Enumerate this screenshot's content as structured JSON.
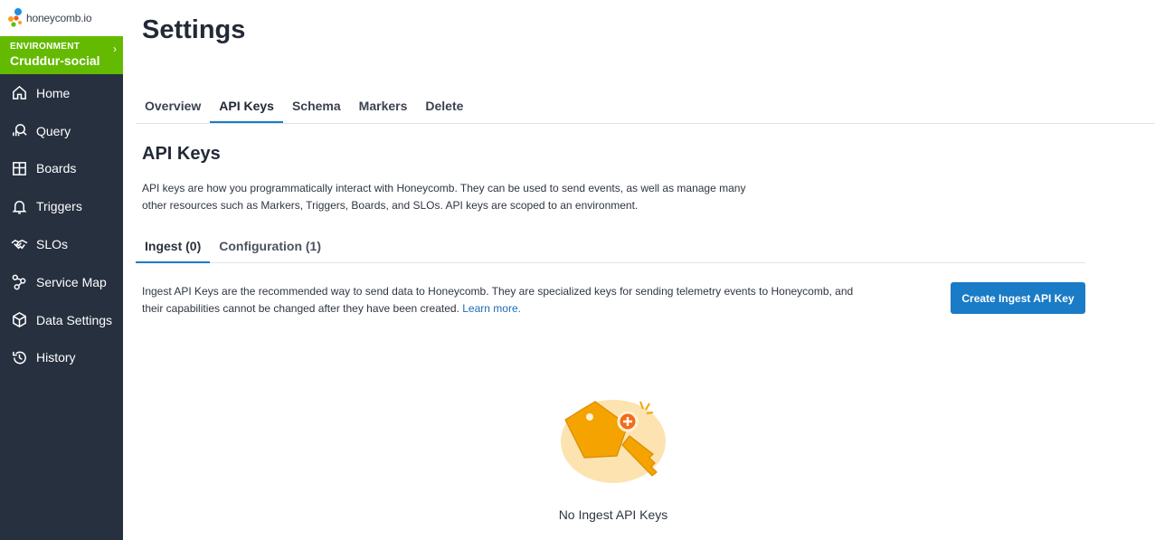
{
  "app": {
    "logo_text": "honeycomb.io"
  },
  "environment": {
    "label": "ENVIRONMENT",
    "name": "Cruddur-social"
  },
  "sidebar": {
    "items": [
      {
        "label": "Home",
        "icon": "home-icon"
      },
      {
        "label": "Query",
        "icon": "query-icon"
      },
      {
        "label": "Boards",
        "icon": "boards-icon"
      },
      {
        "label": "Triggers",
        "icon": "bell-icon"
      },
      {
        "label": "SLOs",
        "icon": "handshake-icon"
      },
      {
        "label": "Service Map",
        "icon": "service-map-icon"
      },
      {
        "label": "Data Settings",
        "icon": "cube-icon"
      },
      {
        "label": "History",
        "icon": "history-icon"
      }
    ]
  },
  "page": {
    "title": "Settings"
  },
  "tabs": [
    {
      "label": "Overview",
      "active": false
    },
    {
      "label": "API Keys",
      "active": true
    },
    {
      "label": "Schema",
      "active": false
    },
    {
      "label": "Markers",
      "active": false
    },
    {
      "label": "Delete",
      "active": false
    }
  ],
  "api_keys": {
    "title": "API Keys",
    "description": "API keys are how you programmatically interact with Honeycomb. They can be used to send events, as well as manage many other resources such as Markers, Triggers, Boards, and SLOs. API keys are scoped to an environment.",
    "subtabs": [
      {
        "label": "Ingest (0)",
        "active": true
      },
      {
        "label": "Configuration (1)",
        "active": false
      }
    ],
    "ingest": {
      "description": "Ingest API Keys are the recommended way to send data to Honeycomb. They are specialized keys for sending telemetry events to Honeycomb, and their capabilities cannot be changed after they have been created.",
      "learn_more": "Learn more.",
      "create_button": "Create Ingest API Key",
      "empty_state": "No Ingest API Keys"
    }
  },
  "colors": {
    "sidebar": "#26303f",
    "environment": "#64ba00",
    "accent": "#1a7bc7",
    "key": "#f5a300"
  }
}
